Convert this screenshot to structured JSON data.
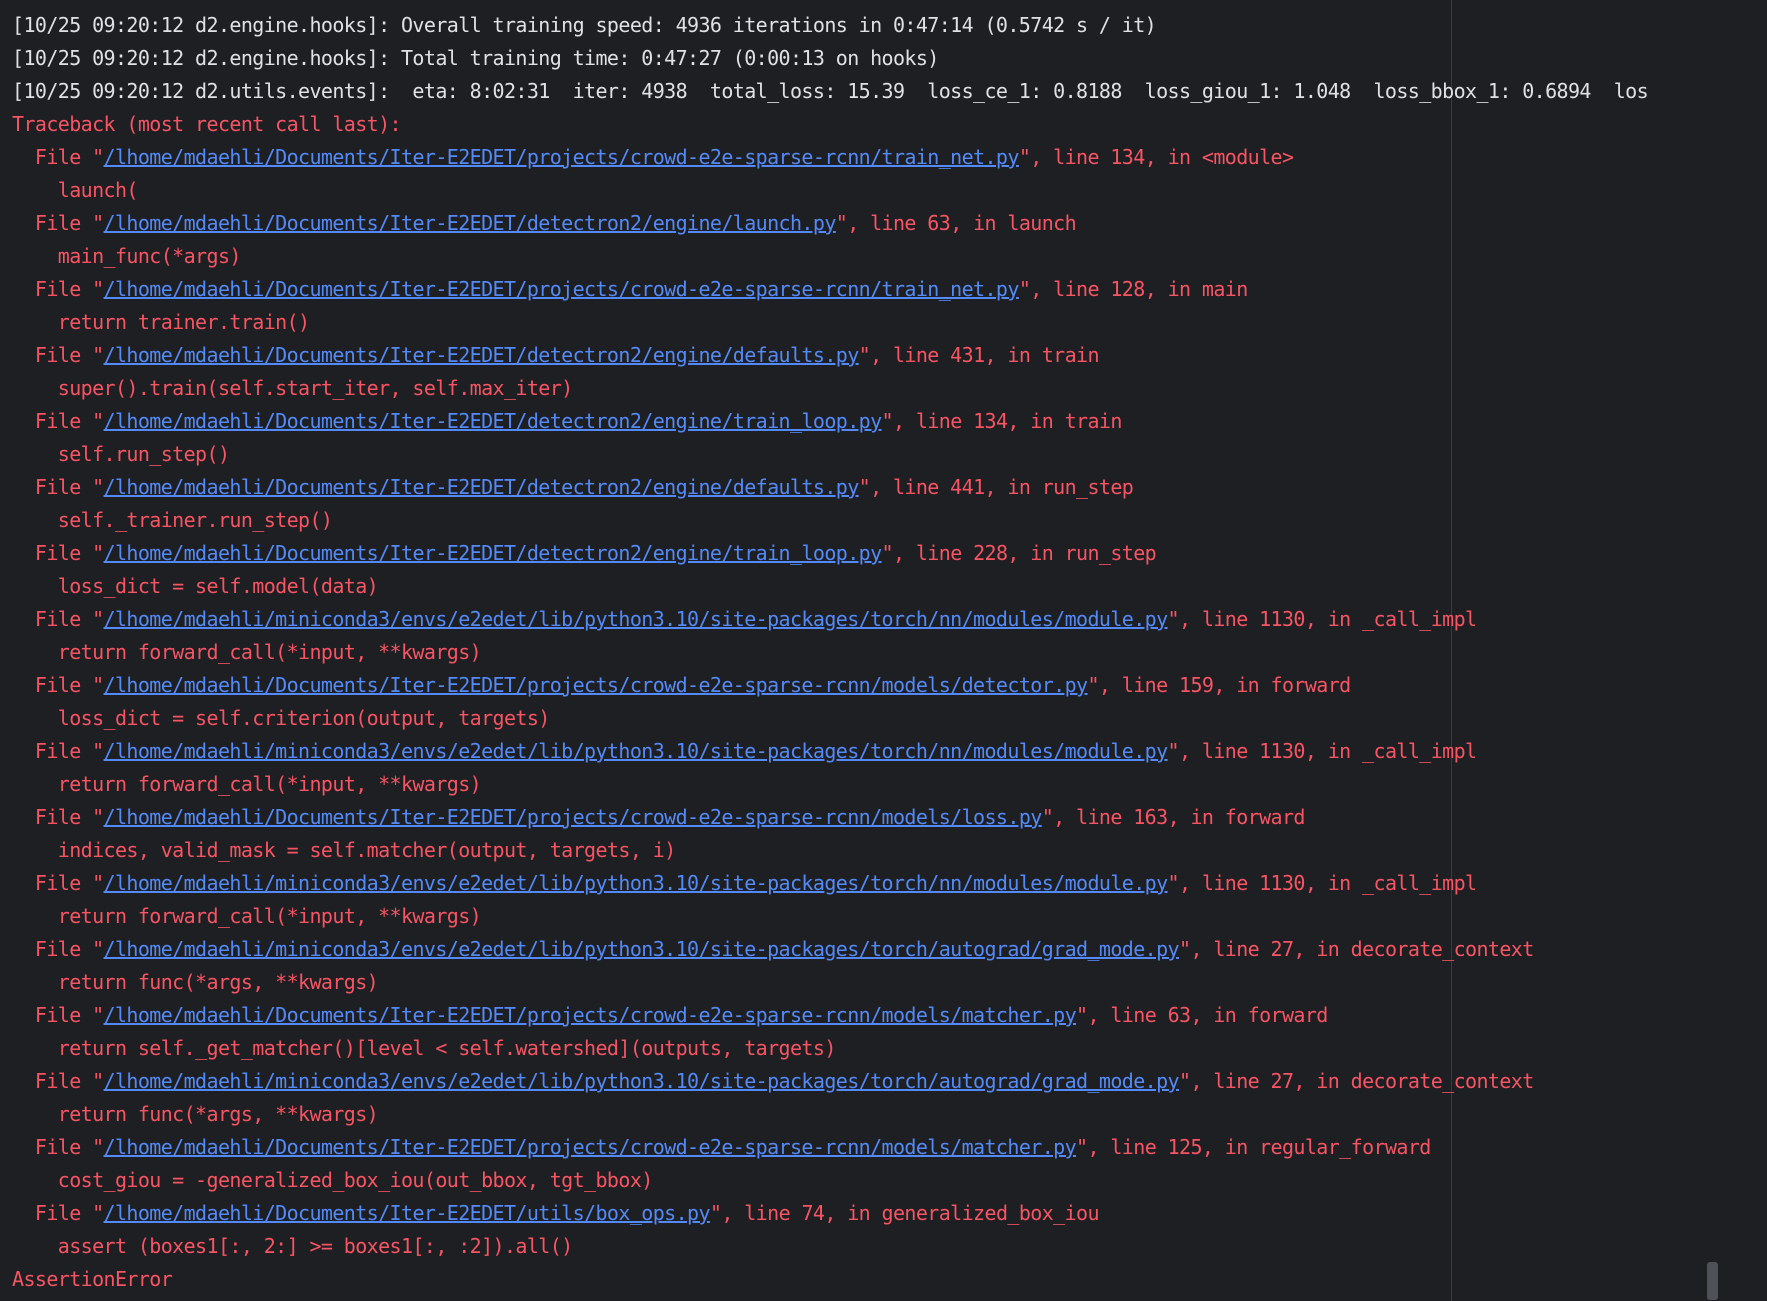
{
  "console": {
    "log_lines": [
      "[10/25 09:20:12 d2.engine.hooks]: Overall training speed: 4936 iterations in 0:47:14 (0.5742 s / it)",
      "[10/25 09:20:12 d2.engine.hooks]: Total training time: 0:47:27 (0:00:13 on hooks)",
      "[10/25 09:20:12 d2.utils.events]:  eta: 8:02:31  iter: 4938  total_loss: 15.39  loss_ce_1: 0.8188  loss_giou_1: 1.048  loss_bbox_1: 0.6894  los"
    ],
    "traceback_header": "Traceback (most recent call last):",
    "frames": [
      {
        "path": "/lhome/mdaehli/Documents/Iter-E2EDET/projects/crowd-e2e-sparse-rcnn/train_net.py",
        "location": ", line 134, in <module>",
        "code": "launch("
      },
      {
        "path": "/lhome/mdaehli/Documents/Iter-E2EDET/detectron2/engine/launch.py",
        "location": ", line 63, in launch",
        "code": "main_func(*args)"
      },
      {
        "path": "/lhome/mdaehli/Documents/Iter-E2EDET/projects/crowd-e2e-sparse-rcnn/train_net.py",
        "location": ", line 128, in main",
        "code": "return trainer.train()"
      },
      {
        "path": "/lhome/mdaehli/Documents/Iter-E2EDET/detectron2/engine/defaults.py",
        "location": ", line 431, in train",
        "code": "super().train(self.start_iter, self.max_iter)"
      },
      {
        "path": "/lhome/mdaehli/Documents/Iter-E2EDET/detectron2/engine/train_loop.py",
        "location": ", line 134, in train",
        "code": "self.run_step()"
      },
      {
        "path": "/lhome/mdaehli/Documents/Iter-E2EDET/detectron2/engine/defaults.py",
        "location": ", line 441, in run_step",
        "code": "self._trainer.run_step()"
      },
      {
        "path": "/lhome/mdaehli/Documents/Iter-E2EDET/detectron2/engine/train_loop.py",
        "location": ", line 228, in run_step",
        "code": "loss_dict = self.model(data)"
      },
      {
        "path": "/lhome/mdaehli/miniconda3/envs/e2edet/lib/python3.10/site-packages/torch/nn/modules/module.py",
        "location": ", line 1130, in _call_impl",
        "code": "return forward_call(*input, **kwargs)"
      },
      {
        "path": "/lhome/mdaehli/Documents/Iter-E2EDET/projects/crowd-e2e-sparse-rcnn/models/detector.py",
        "location": ", line 159, in forward",
        "code": "loss_dict = self.criterion(output, targets)"
      },
      {
        "path": "/lhome/mdaehli/miniconda3/envs/e2edet/lib/python3.10/site-packages/torch/nn/modules/module.py",
        "location": ", line 1130, in _call_impl",
        "code": "return forward_call(*input, **kwargs)"
      },
      {
        "path": "/lhome/mdaehli/Documents/Iter-E2EDET/projects/crowd-e2e-sparse-rcnn/models/loss.py",
        "location": ", line 163, in forward",
        "code": "indices, valid_mask = self.matcher(output, targets, i)"
      },
      {
        "path": "/lhome/mdaehli/miniconda3/envs/e2edet/lib/python3.10/site-packages/torch/nn/modules/module.py",
        "location": ", line 1130, in _call_impl",
        "code": "return forward_call(*input, **kwargs)"
      },
      {
        "path": "/lhome/mdaehli/miniconda3/envs/e2edet/lib/python3.10/site-packages/torch/autograd/grad_mode.py",
        "location": ", line 27, in decorate_context",
        "code": "return func(*args, **kwargs)"
      },
      {
        "path": "/lhome/mdaehli/Documents/Iter-E2EDET/projects/crowd-e2e-sparse-rcnn/models/matcher.py",
        "location": ", line 63, in forward",
        "code": "return self._get_matcher()[level < self.watershed](outputs, targets)"
      },
      {
        "path": "/lhome/mdaehli/miniconda3/envs/e2edet/lib/python3.10/site-packages/torch/autograd/grad_mode.py",
        "location": ", line 27, in decorate_context",
        "code": "return func(*args, **kwargs)"
      },
      {
        "path": "/lhome/mdaehli/Documents/Iter-E2EDET/projects/crowd-e2e-sparse-rcnn/models/matcher.py",
        "location": ", line 125, in regular_forward",
        "code": "cost_giou = -generalized_box_iou(out_bbox, tgt_bbox)"
      },
      {
        "path": "/lhome/mdaehli/Documents/Iter-E2EDET/utils/box_ops.py",
        "location": ", line 74, in generalized_box_iou",
        "code": "assert (boxes1[:, 2:] >= boxes1[:, :2]).all()"
      }
    ],
    "error_line": "AssertionError"
  },
  "colors": {
    "background": "#1e1f22",
    "log_text": "#dfe1e5",
    "error_text": "#f75464",
    "link": "#548af7"
  }
}
